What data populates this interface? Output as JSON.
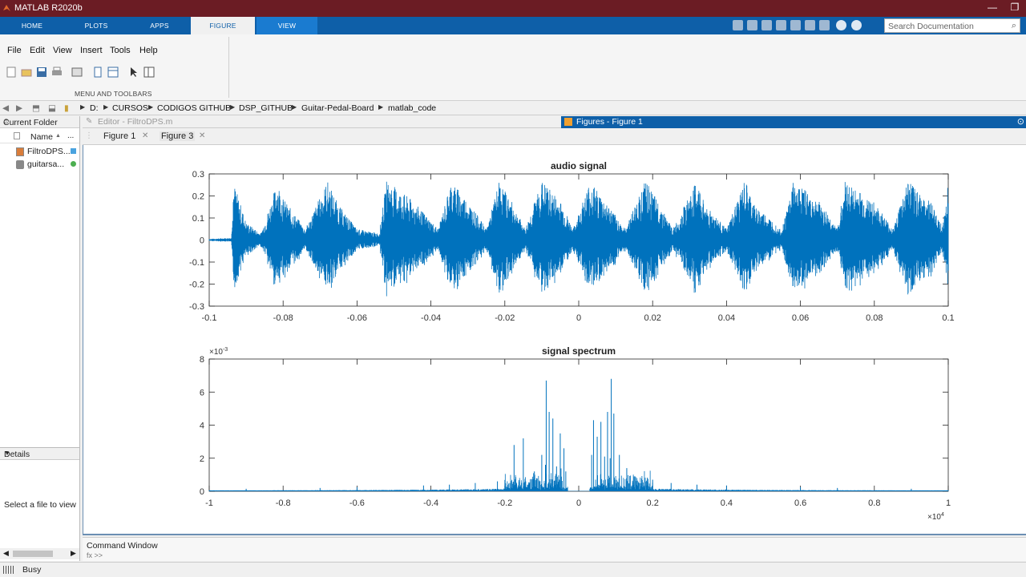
{
  "window": {
    "title": "MATLAB R2020b",
    "minimize": "—",
    "restore": "❐"
  },
  "ribbon": {
    "tabs": [
      "HOME",
      "PLOTS",
      "APPS",
      "FIGURE",
      "VIEW"
    ],
    "active_tab": "FIGURE",
    "search_placeholder": "Search Documentation",
    "section_label": "MENU AND TOOLBARS"
  },
  "menubar": [
    "File",
    "Edit",
    "View",
    "Insert",
    "Tools",
    "Help"
  ],
  "address": {
    "path": [
      "D:",
      "CURSOS",
      "CODIGOS GITHUB",
      "DSP_GITHUB",
      "Guitar-Pedal-Board",
      "matlab_code"
    ]
  },
  "current_folder": {
    "title": "Current Folder",
    "column": "Name",
    "sort": "▲",
    "more": "...",
    "files": [
      {
        "name": "FiltroDPS...",
        "icon": "mfile-icon"
      },
      {
        "name": "guitarsa...",
        "icon": "audio-file-icon"
      }
    ],
    "details_title": "Details",
    "details_msg": "Select a file to view"
  },
  "editor": {
    "title": "Editor - FiltroDPS.m"
  },
  "figures_panel": {
    "title": "Figures - Figure 1",
    "tabs": [
      "Figure 1",
      "Figure 3"
    ],
    "active_tab": "Figure 1"
  },
  "command_window": {
    "title": "Command Window",
    "prompt": "fx >>"
  },
  "status": {
    "text": "Busy"
  },
  "colors": {
    "signal": "#0072bd",
    "title_bar": "#6b1c24",
    "ribbon": "#0e5fa8"
  },
  "chart_data": [
    {
      "type": "line",
      "title": "audio signal",
      "xlabel": "",
      "ylabel": "",
      "xlim": [
        -0.1,
        0.1
      ],
      "ylim": [
        -0.3,
        0.3
      ],
      "xticks": [
        "-0.1",
        "-0.08",
        "-0.06",
        "-0.04",
        "-0.02",
        "0",
        "0.02",
        "0.04",
        "0.06",
        "0.08",
        "0.1"
      ],
      "yticks": [
        "-0.3",
        "-0.2",
        "-0.1",
        "0",
        "0.1",
        "0.2",
        "0.3"
      ],
      "envelope_x": [
        -0.1,
        -0.094,
        -0.0935,
        -0.09,
        -0.086,
        -0.0815,
        -0.08,
        -0.074,
        -0.068,
        -0.065,
        -0.06,
        -0.054,
        -0.052,
        -0.045,
        -0.038,
        -0.0345,
        -0.03,
        -0.025,
        -0.0215,
        -0.018,
        -0.0145,
        -0.01,
        -0.005,
        -0.0015,
        0.003,
        0.008,
        0.0125,
        0.018,
        0.022,
        0.0255,
        0.032,
        0.034,
        0.04,
        0.045,
        0.0475,
        0.055,
        0.058,
        0.0655,
        0.07,
        0.072,
        0.08,
        0.085,
        0.089,
        0.095,
        0.0985,
        0.1
      ],
      "envelope_amp": [
        0.005,
        0.01,
        0.27,
        0.08,
        0.03,
        0.27,
        0.19,
        0.05,
        0.27,
        0.16,
        0.05,
        0.03,
        0.27,
        0.18,
        0.05,
        0.27,
        0.18,
        0.05,
        0.27,
        0.17,
        0.05,
        0.27,
        0.18,
        0.05,
        0.27,
        0.16,
        0.05,
        0.27,
        0.16,
        0.05,
        0.27,
        0.17,
        0.05,
        0.27,
        0.16,
        0.05,
        0.27,
        0.17,
        0.05,
        0.27,
        0.17,
        0.05,
        0.27,
        0.18,
        0.06,
        0.27
      ]
    },
    {
      "type": "line",
      "title": "signal spectrum",
      "xlabel": "",
      "ylabel": "",
      "x_exponent": "×10^4",
      "y_exponent": "×10^-3",
      "xlim": [
        -1,
        1
      ],
      "ylim": [
        0,
        8
      ],
      "xticks": [
        "-1",
        "-0.8",
        "-0.6",
        "-0.4",
        "-0.2",
        "0",
        "0.2",
        "0.4",
        "0.6",
        "0.8",
        "1"
      ],
      "yticks": [
        "0",
        "2",
        "4",
        "6",
        "8"
      ],
      "peaks_x": [
        -0.175,
        -0.15,
        -0.12,
        -0.1,
        -0.09,
        -0.088,
        -0.08,
        -0.07,
        -0.06,
        -0.05,
        -0.04,
        -0.035,
        0.035,
        0.04,
        0.05,
        0.06,
        0.07,
        0.078,
        0.085,
        0.088,
        0.095,
        0.11,
        0.13,
        0.15,
        0.2,
        -0.22,
        -0.28,
        -0.35,
        0.25,
        0.32,
        -0.42,
        0.4,
        -0.6,
        0.6,
        -0.7,
        0.7,
        -0.9,
        0.9
      ],
      "peaks_y": [
        2.8,
        3.2,
        1.2,
        2.2,
        1.6,
        6.7,
        4.8,
        4.4,
        1.5,
        3.5,
        2.6,
        1.2,
        2.2,
        4.3,
        3.3,
        4.2,
        2.1,
        4.8,
        2.0,
        6.8,
        4.7,
        2.2,
        1.4,
        0.9,
        0.7,
        0.6,
        0.5,
        0.4,
        0.5,
        0.4,
        0.35,
        0.35,
        0.25,
        0.25,
        0.2,
        0.2,
        0.15,
        0.15
      ]
    }
  ]
}
